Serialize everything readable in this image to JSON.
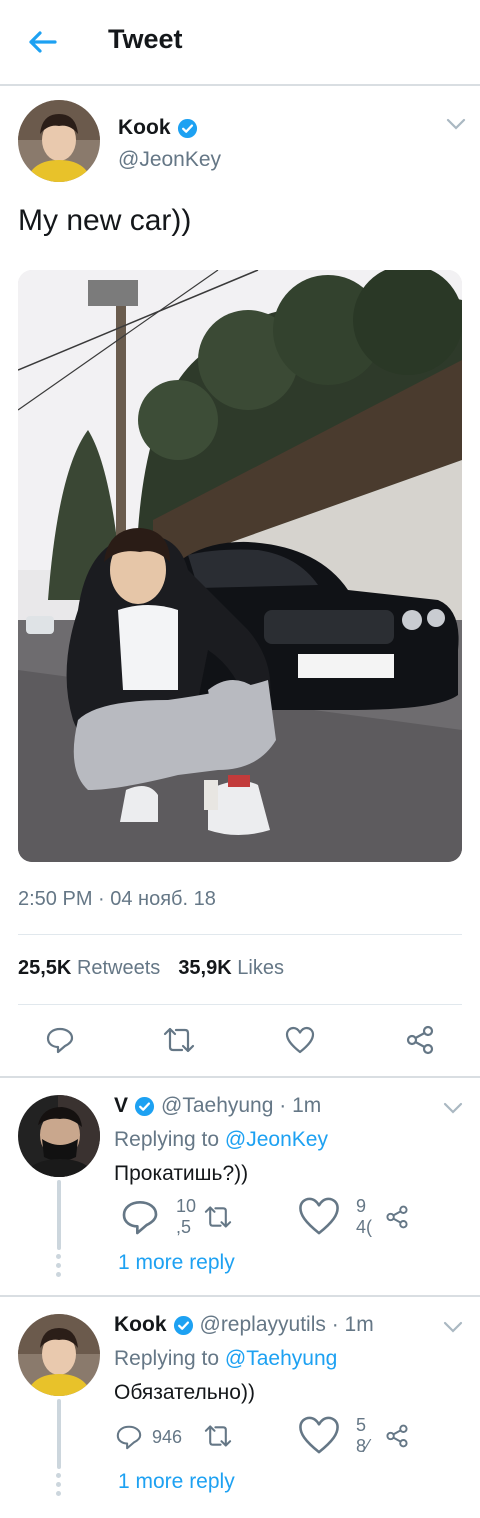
{
  "header": {
    "title": "Tweet",
    "back_icon": "arrow-left-icon",
    "accent": "#1da1f2"
  },
  "tweet": {
    "author_name": "Kook",
    "author_handle": "@JeonKey",
    "verified": true,
    "text": "My new car))",
    "time": "2:50 PM · 04 нояб. 18",
    "retweets_count": "25,5K",
    "retweets_label": "Retweets",
    "likes_count": "35,9K",
    "likes_label": "Likes",
    "actions": [
      "reply-icon",
      "retweet-icon",
      "like-icon",
      "share-icon"
    ]
  },
  "replies": [
    {
      "name": "V",
      "handle": "@Taehyung · 1m",
      "replying_prefix": "Replying to ",
      "replying_to": "@JeonKey",
      "text": "Прокатишь?))",
      "reply_count_line1": "10",
      "reply_count_line2": ",5",
      "like_count_line1": "9",
      "like_count_line2": "4(",
      "more": "1 more reply"
    },
    {
      "name": "Kook",
      "handle": "@replayyutils · 1m",
      "replying_prefix": "Replying to ",
      "replying_to": "@Taehyung",
      "text": "Обязательно))",
      "reply_count": "946",
      "like_count_line1": "5",
      "like_count_line2": "8⁄",
      "more": "1 more reply"
    }
  ]
}
